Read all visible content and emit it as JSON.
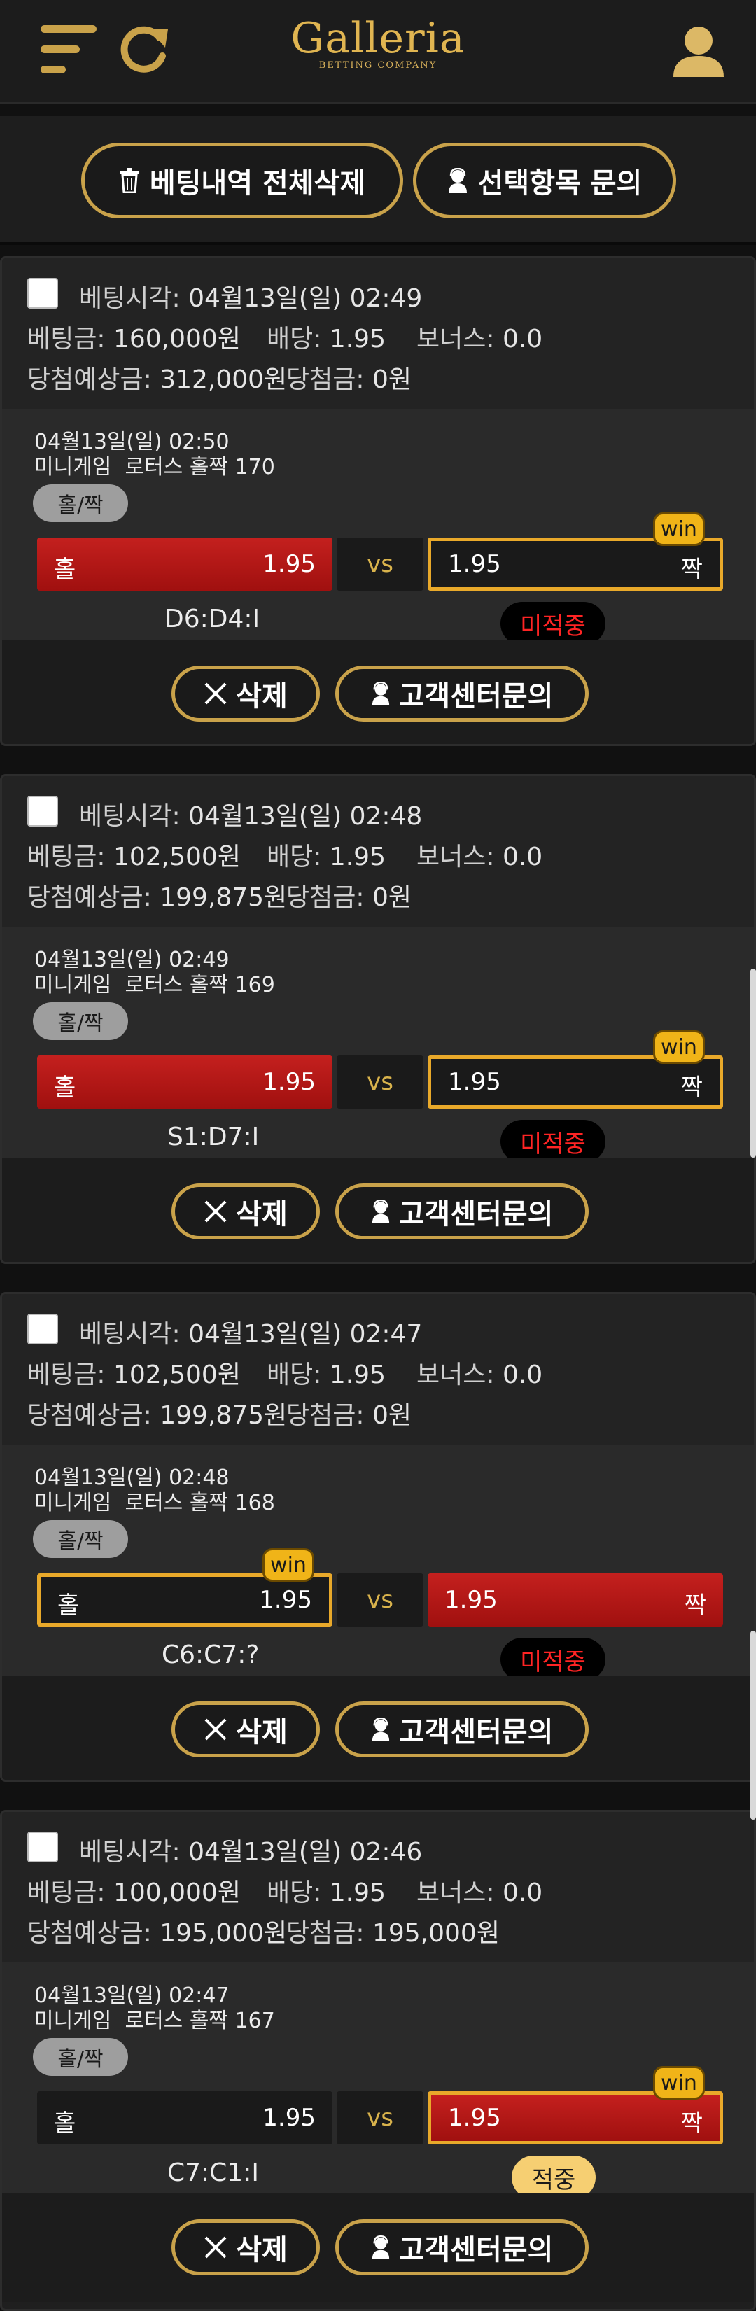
{
  "header": {
    "logo_text": "Galleria",
    "logo_subtitle": "BETTING COMPANY",
    "colors": {
      "accent": "#c9a24a",
      "background": "#111111"
    }
  },
  "actions": {
    "delete_all_label": "베팅내역 전체삭제",
    "inquire_selected_label": "선택항목 문의"
  },
  "labels": {
    "bet_time": "베팅시각:",
    "bet_amount": "베팅금:",
    "odds": "배당:",
    "bonus": "보너스:",
    "expected_payout": "당첨예상금:",
    "payout": "당첨금:",
    "vs": "vs",
    "win": "win",
    "delete": "삭제",
    "support": "고객센터문의"
  },
  "bets": [
    {
      "bet_time": "04월13일(일) 02:49",
      "amount": "160,000원",
      "odds": "1.95",
      "bonus": "0.0",
      "expected": "312,000원",
      "payout": "0원",
      "game_time": "04월13일(일) 02:50",
      "game_type": "미니게임",
      "game_name": "로터스 홀짝 170",
      "market": "홀/짝",
      "home_label": "홀",
      "home_odds": "1.95",
      "away_label": "짝",
      "away_odds": "1.95",
      "result": "D6:D4:I",
      "status": "미적중"
    },
    {
      "bet_time": "04월13일(일) 02:48",
      "amount": "102,500원",
      "odds": "1.95",
      "bonus": "0.0",
      "expected": "199,875원",
      "payout": "0원",
      "game_time": "04월13일(일) 02:49",
      "game_type": "미니게임",
      "game_name": "로터스 홀짝 169",
      "market": "홀/짝",
      "home_label": "홀",
      "home_odds": "1.95",
      "away_label": "짝",
      "away_odds": "1.95",
      "result": "S1:D7:I",
      "status": "미적중"
    },
    {
      "bet_time": "04월13일(일) 02:47",
      "amount": "102,500원",
      "odds": "1.95",
      "bonus": "0.0",
      "expected": "199,875원",
      "payout": "0원",
      "game_time": "04월13일(일) 02:48",
      "game_type": "미니게임",
      "game_name": "로터스 홀짝 168",
      "market": "홀/짝",
      "home_label": "홀",
      "home_odds": "1.95",
      "away_label": "짝",
      "away_odds": "1.95",
      "result": "C6:C7:?",
      "status": "미적중"
    },
    {
      "bet_time": "04월13일(일) 02:46",
      "amount": "100,000원",
      "odds": "1.95",
      "bonus": "0.0",
      "expected": "195,000원",
      "payout": "195,000원",
      "game_time": "04월13일(일) 02:47",
      "game_type": "미니게임",
      "game_name": "로터스 홀짝 167",
      "market": "홀/짝",
      "home_label": "홀",
      "home_odds": "1.95",
      "away_label": "짝",
      "away_odds": "1.95",
      "result": "C7:C1:I",
      "status": "적중"
    }
  ]
}
